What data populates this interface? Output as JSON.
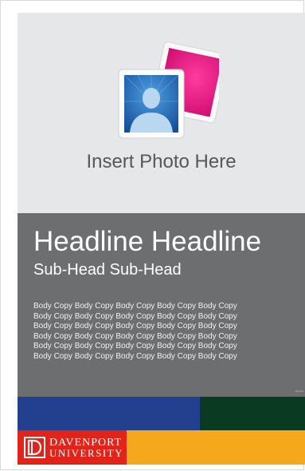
{
  "photo": {
    "caption": "Insert Photo Here",
    "icon": "photo-placeholder-icon"
  },
  "text_block": {
    "headline": "Headline Headline",
    "subhead": "Sub-Head Sub-Head",
    "body_lines": [
      "Body Copy Body Copy Body Copy Body Copy Body Copy",
      "Body Copy Body Copy Body Copy Body Copy Body Copy",
      "Body Copy Body Copy Body Copy Body Copy Body Copy",
      "Body Copy Body Copy Body Copy Body Copy Body Copy",
      "Body Copy Body Copy Body Copy Body Copy Body Copy",
      "Body Copy Body Copy Body Copy Body Copy Body Copy"
    ]
  },
  "logo": {
    "line1": "DAVENPORT",
    "line2": "UNIVERSITY",
    "icon": "davenport-logo-icon"
  },
  "colors": {
    "photo_bg": "#e6e7e8",
    "text_bg": "#6d6e70",
    "blue_band": "#23408f",
    "green_band": "#0b3a23",
    "logo_red": "#e2231a",
    "gold_band": "#f5a81c",
    "photo_pink": "#e5137d"
  }
}
